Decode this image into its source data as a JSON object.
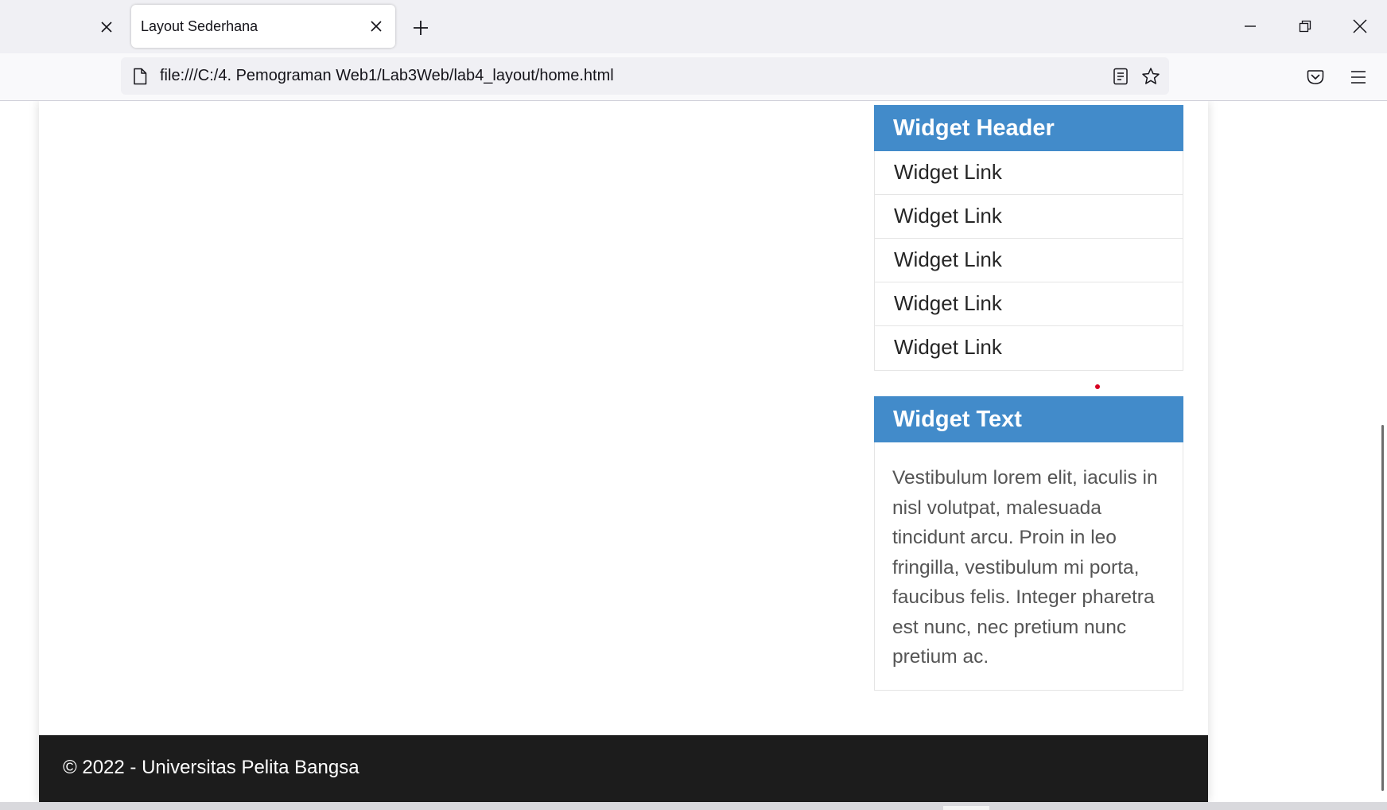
{
  "browser": {
    "tab_title": "Layout Sederhana",
    "url": "file:///C:/4. Pemograman Web1/Lab3Web/lab4_layout/home.html",
    "icons": {
      "prev_tab_close": "close-icon",
      "tab_close": "close-icon",
      "new_tab": "plus-icon",
      "minimize": "minimize-icon",
      "restore": "restore-icon",
      "close_window": "close-icon",
      "page": "page-icon",
      "reader": "reader-view-icon",
      "bookmark": "star-icon",
      "pocket": "pocket-icon",
      "menu": "hamburger-menu-icon"
    }
  },
  "sidebar": {
    "links_widget": {
      "header": "Widget Header",
      "links": [
        "Widget Link",
        "Widget Link",
        "Widget Link",
        "Widget Link",
        "Widget Link"
      ]
    },
    "text_widget": {
      "header": "Widget Text",
      "body": "Vestibulum lorem elit, iaculis in nisl volutpat, malesuada tincidunt arcu. Proin in leo fringilla, vestibulum mi porta, faucibus felis. Integer pharetra est nunc, nec pretium nunc pretium ac."
    }
  },
  "footer": {
    "text": "© 2022 - Universitas Pelita Bangsa"
  },
  "colors": {
    "widget_header_bg": "#428bca",
    "footer_bg": "#1c1c1c",
    "chrome_bg": "#f0f0f4"
  }
}
